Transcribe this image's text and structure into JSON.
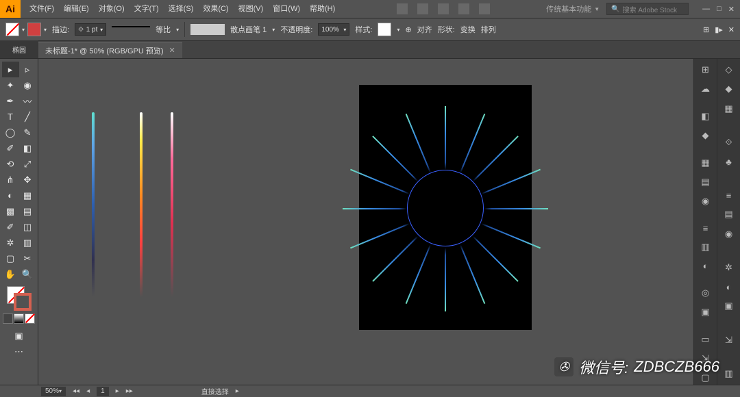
{
  "app": {
    "logo": "Ai"
  },
  "menu": {
    "file": "文件(F)",
    "edit": "编辑(E)",
    "object": "对象(O)",
    "type": "文字(T)",
    "select": "选择(S)",
    "effect": "效果(C)",
    "view": "视图(V)",
    "window": "窗口(W)",
    "help": "帮助(H)"
  },
  "workspace": {
    "name": "传统基本功能"
  },
  "search": {
    "placeholder": "搜索 Adobe Stock"
  },
  "panel_label": "椭圆",
  "options": {
    "stroke_label": "描边:",
    "stroke_weight": "1 pt",
    "ratio": "等比",
    "brush": "散点画笔 1",
    "opacity_label": "不透明度:",
    "opacity": "100%",
    "style_label": "样式:",
    "align": "对齐",
    "shape": "形状:",
    "transform": "变换",
    "arrange": "排列"
  },
  "tab": {
    "title": "未标题-1* @ 50% (RGB/GPU 预览)"
  },
  "status": {
    "zoom": "50%",
    "page": "1",
    "mode": "直接选择"
  },
  "watermark": {
    "label": "微信号:",
    "id": "ZDBCZB666"
  }
}
